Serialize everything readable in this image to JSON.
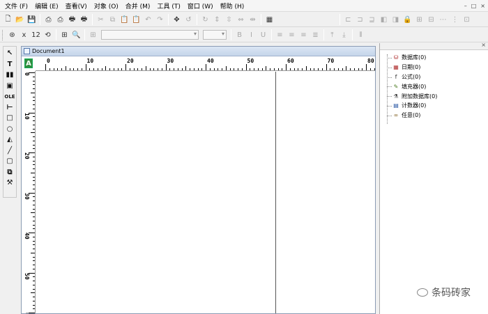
{
  "menu": [
    "文件 (F)",
    "编辑 (E)",
    "查看(V)",
    "对象 (O)",
    "合并 (M)",
    "工具 (T)",
    "窗口 (W)",
    "帮助 (H)"
  ],
  "menu_right": [
    "–",
    "□",
    "×"
  ],
  "toolbar1_icons": [
    "new-icon",
    "open-icon",
    "save-icon",
    "print-preview-icon",
    "print-setup-icon",
    "print-icon",
    "printer-icon",
    "cut-icon",
    "copy-icon",
    "paste-icon",
    "paste-special-icon",
    "undo-icon",
    "redo-icon",
    "move-icon",
    "rotate-left-icon",
    "rotate-right-icon",
    "flip-vertical-icon",
    "flip-v2-icon",
    "flip-horizontal-icon",
    "flip-h2-icon",
    "picture-icon"
  ],
  "toolbar1_right_icons": [
    "align-left-icon",
    "align-center-icon",
    "align-right-icon",
    "bring-front-icon",
    "send-back-icon",
    "lock-icon",
    "group-icon",
    "ungroup-icon",
    "spacing-h-icon",
    "spacing-v-icon",
    "size-icon"
  ],
  "toolbar2_icons": [
    "zoom-fit-icon",
    "zoom-out-icon",
    "counter-icon",
    "rotate-text-icon",
    "grid-icon",
    "search-icon"
  ],
  "toolbar2_text_icons": [
    "bold-icon",
    "italic-icon",
    "underline-icon",
    "text-left-icon",
    "text-center-icon",
    "text-right-icon",
    "justify-icon",
    "text-top-icon",
    "text-bottom-icon",
    "barcode-settings-icon"
  ],
  "tools": [
    {
      "name": "select-tool-icon",
      "glyph": "↖"
    },
    {
      "name": "text-tool-icon",
      "glyph": "T"
    },
    {
      "name": "barcode-tool-icon",
      "glyph": "▮▮"
    },
    {
      "name": "image-tool-icon",
      "glyph": "▣"
    },
    {
      "name": "ole-tool-icon",
      "glyph": "OLE"
    },
    {
      "name": "line-tool-icon",
      "glyph": "⊢"
    },
    {
      "name": "rectangle-tool-icon",
      "glyph": "□"
    },
    {
      "name": "ellipse-tool-icon",
      "glyph": "○"
    },
    {
      "name": "polygon-tool-icon",
      "glyph": "◭"
    },
    {
      "name": "diagonal-line-tool-icon",
      "glyph": "╱"
    },
    {
      "name": "rounded-rect-tool-icon",
      "glyph": "▢"
    },
    {
      "name": "shape-tool-icon",
      "glyph": "⧉"
    },
    {
      "name": "edit-tool-icon",
      "glyph": "⚒"
    }
  ],
  "document": {
    "title": "Document1",
    "corner_label": "A",
    "hruler_labels": [
      "0",
      "10",
      "20",
      "30",
      "40",
      "50",
      "60",
      "70",
      "80"
    ],
    "vruler_labels": [
      "0",
      "10",
      "20",
      "30",
      "40",
      "50",
      "60"
    ]
  },
  "datasources": [
    {
      "icon": "database-icon",
      "label": "数据库(0)",
      "color": "#b03030",
      "glyph": "⛁"
    },
    {
      "icon": "date-icon",
      "label": "日期(0)",
      "color": "#b03030",
      "glyph": "▦"
    },
    {
      "icon": "formula-icon",
      "label": "公式(0)",
      "color": "#333333",
      "glyph": "f"
    },
    {
      "icon": "fill-icon",
      "label": "填充器(0)",
      "color": "#4a7a20",
      "glyph": "✎"
    },
    {
      "icon": "extra-database-icon",
      "label": "附加数据库(0)",
      "color": "#333333",
      "glyph": "⚗"
    },
    {
      "icon": "counter-icon",
      "label": "计数器(0)",
      "color": "#2050a0",
      "glyph": "▤"
    },
    {
      "icon": "any-icon",
      "label": "任意(0)",
      "color": "#806020",
      "glyph": "∞"
    }
  ],
  "watermark": "条码砖家"
}
